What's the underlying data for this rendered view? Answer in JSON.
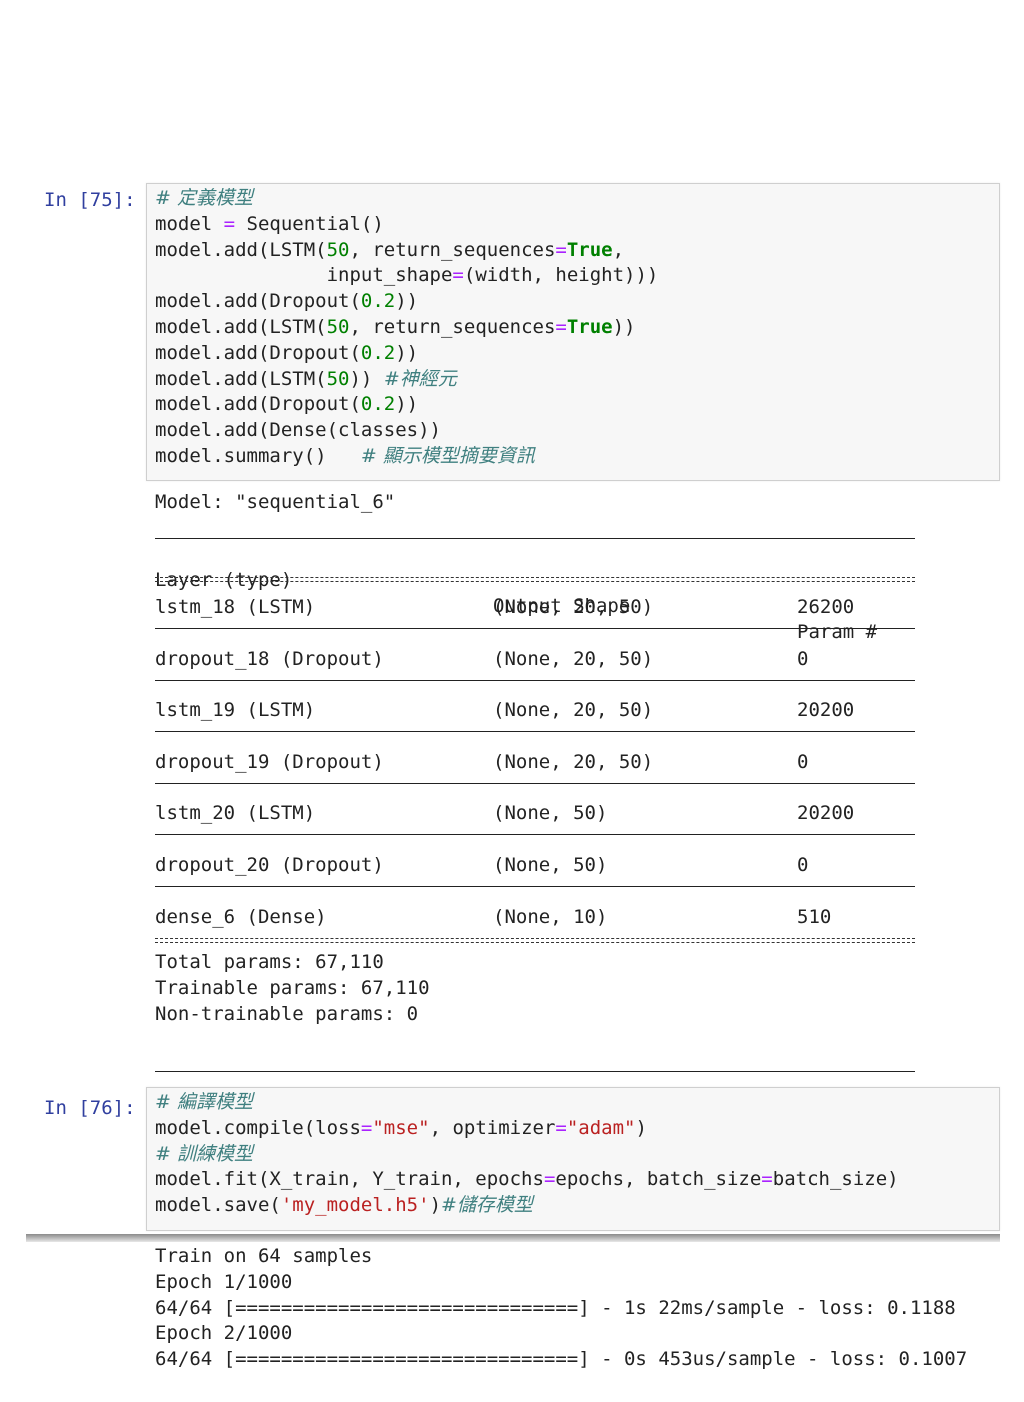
{
  "cell75": {
    "prompt": "In [75]:",
    "code_lines": [
      [
        {
          "t": "# 定義模型",
          "k": "cm"
        }
      ],
      [
        {
          "t": "model ",
          "k": ""
        },
        {
          "t": "=",
          "k": "op"
        },
        {
          "t": " Sequential()",
          "k": ""
        }
      ],
      [
        {
          "t": "model.add(LSTM(",
          "k": ""
        },
        {
          "t": "50",
          "k": "num"
        },
        {
          "t": ", return_sequences",
          "k": ""
        },
        {
          "t": "=",
          "k": "op"
        },
        {
          "t": "True",
          "k": "kw"
        },
        {
          "t": ",",
          "k": ""
        }
      ],
      [
        {
          "t": "               input_shape",
          "k": ""
        },
        {
          "t": "=",
          "k": "op"
        },
        {
          "t": "(width, height)))",
          "k": ""
        }
      ],
      [
        {
          "t": "model.add(Dropout(",
          "k": ""
        },
        {
          "t": "0.2",
          "k": "num"
        },
        {
          "t": "))",
          "k": ""
        }
      ],
      [
        {
          "t": "model.add(LSTM(",
          "k": ""
        },
        {
          "t": "50",
          "k": "num"
        },
        {
          "t": ", return_sequences",
          "k": ""
        },
        {
          "t": "=",
          "k": "op"
        },
        {
          "t": "True",
          "k": "kw"
        },
        {
          "t": "))",
          "k": ""
        }
      ],
      [
        {
          "t": "model.add(Dropout(",
          "k": ""
        },
        {
          "t": "0.2",
          "k": "num"
        },
        {
          "t": "))",
          "k": ""
        }
      ],
      [
        {
          "t": "model.add(LSTM(",
          "k": ""
        },
        {
          "t": "50",
          "k": "num"
        },
        {
          "t": ")) ",
          "k": ""
        },
        {
          "t": "#神經元",
          "k": "cm"
        }
      ],
      [
        {
          "t": "model.add(Dropout(",
          "k": ""
        },
        {
          "t": "0.2",
          "k": "num"
        },
        {
          "t": "))",
          "k": ""
        }
      ],
      [
        {
          "t": "model.add(Dense(classes))",
          "k": ""
        }
      ],
      [
        {
          "t": "model.summary()   ",
          "k": ""
        },
        {
          "t": "# 顯示模型摘要資訊",
          "k": "cm"
        }
      ]
    ],
    "model_line": "Model: \"sequential_6\"",
    "table": {
      "headers": [
        "Layer (type)",
        "Output Shape",
        "Param #"
      ],
      "rows": [
        [
          "lstm_18 (LSTM)",
          "(None, 20, 50)",
          "26200"
        ],
        [
          "dropout_18 (Dropout)",
          "(None, 20, 50)",
          "0"
        ],
        [
          "lstm_19 (LSTM)",
          "(None, 20, 50)",
          "20200"
        ],
        [
          "dropout_19 (Dropout)",
          "(None, 20, 50)",
          "0"
        ],
        [
          "lstm_20 (LSTM)",
          "(None, 50)",
          "20200"
        ],
        [
          "dropout_20 (Dropout)",
          "(None, 50)",
          "0"
        ],
        [
          "dense_6 (Dense)",
          "(None, 10)",
          "510"
        ]
      ]
    },
    "totals": [
      "Total params: 67,110",
      "Trainable params: 67,110",
      "Non-trainable params: 0"
    ]
  },
  "cell76": {
    "prompt": "In [76]:",
    "code_lines": [
      [
        {
          "t": "# 編譯模型",
          "k": "cm"
        }
      ],
      [
        {
          "t": "model.compile(loss",
          "k": ""
        },
        {
          "t": "=",
          "k": "op"
        },
        {
          "t": "\"mse\"",
          "k": "str"
        },
        {
          "t": ", optimizer",
          "k": ""
        },
        {
          "t": "=",
          "k": "op"
        },
        {
          "t": "\"adam\"",
          "k": "str"
        },
        {
          "t": ")",
          "k": ""
        }
      ],
      [
        {
          "t": "# 訓練模型",
          "k": "cm"
        }
      ],
      [
        {
          "t": "model.fit(X_train, Y_train, epochs",
          "k": ""
        },
        {
          "t": "=",
          "k": "op"
        },
        {
          "t": "epochs, batch_size",
          "k": ""
        },
        {
          "t": "=",
          "k": "op"
        },
        {
          "t": "batch_size)",
          "k": ""
        }
      ],
      [
        {
          "t": "model.save(",
          "k": ""
        },
        {
          "t": "'my_model.h5'",
          "k": "str"
        },
        {
          "t": ")",
          "k": ""
        },
        {
          "t": "#儲存模型",
          "k": "cm"
        }
      ]
    ],
    "output_lines": [
      "Train on 64 samples",
      "Epoch 1/1000",
      "64/64 [==============================] - 1s 22ms/sample - loss: 0.1188",
      "Epoch 2/1000",
      "64/64 [==============================] - 0s 453us/sample - loss: 0.1007"
    ]
  }
}
